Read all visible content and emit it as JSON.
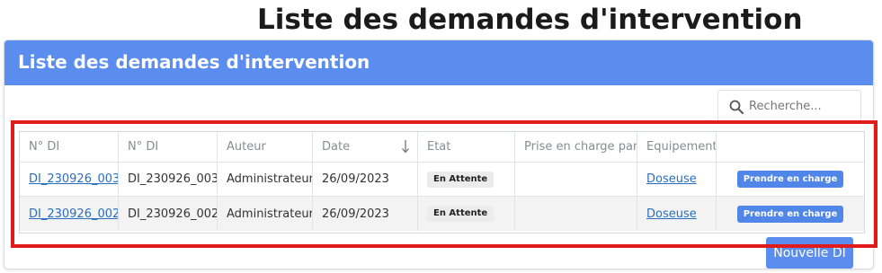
{
  "page_title": "Liste des demandes d'intervention",
  "panel": {
    "title": "Liste des demandes d'intervention"
  },
  "search": {
    "placeholder": "Recherche...",
    "value": ""
  },
  "table": {
    "columns": [
      "N° DI",
      "N° DI",
      "Auteur",
      "Date",
      "Etat",
      "Prise en charge par",
      "Equipement",
      ""
    ],
    "sort_column": "Date",
    "rows": [
      {
        "di_link": "DI_230926_003",
        "di": "DI_230926_003",
        "auteur": "Administrateur",
        "date": "26/09/2023",
        "etat": "En Attente",
        "prise_en_charge_par": "",
        "equipement": "Doseuse",
        "action": "Prendre en charge"
      },
      {
        "di_link": "DI_230926_002",
        "di": "DI_230926_002",
        "auteur": "Administrateur",
        "date": "26/09/2023",
        "etat": "En Attente",
        "prise_en_charge_par": "",
        "equipement": "Doseuse",
        "action": "Prendre en charge"
      }
    ]
  },
  "new_button": {
    "label": "Nouvelle DI"
  },
  "colors": {
    "header_blue": "#5b8def",
    "button_blue": "#4f86e8",
    "link_blue": "#2a6ebf",
    "highlight_red": "#e01b1b"
  }
}
